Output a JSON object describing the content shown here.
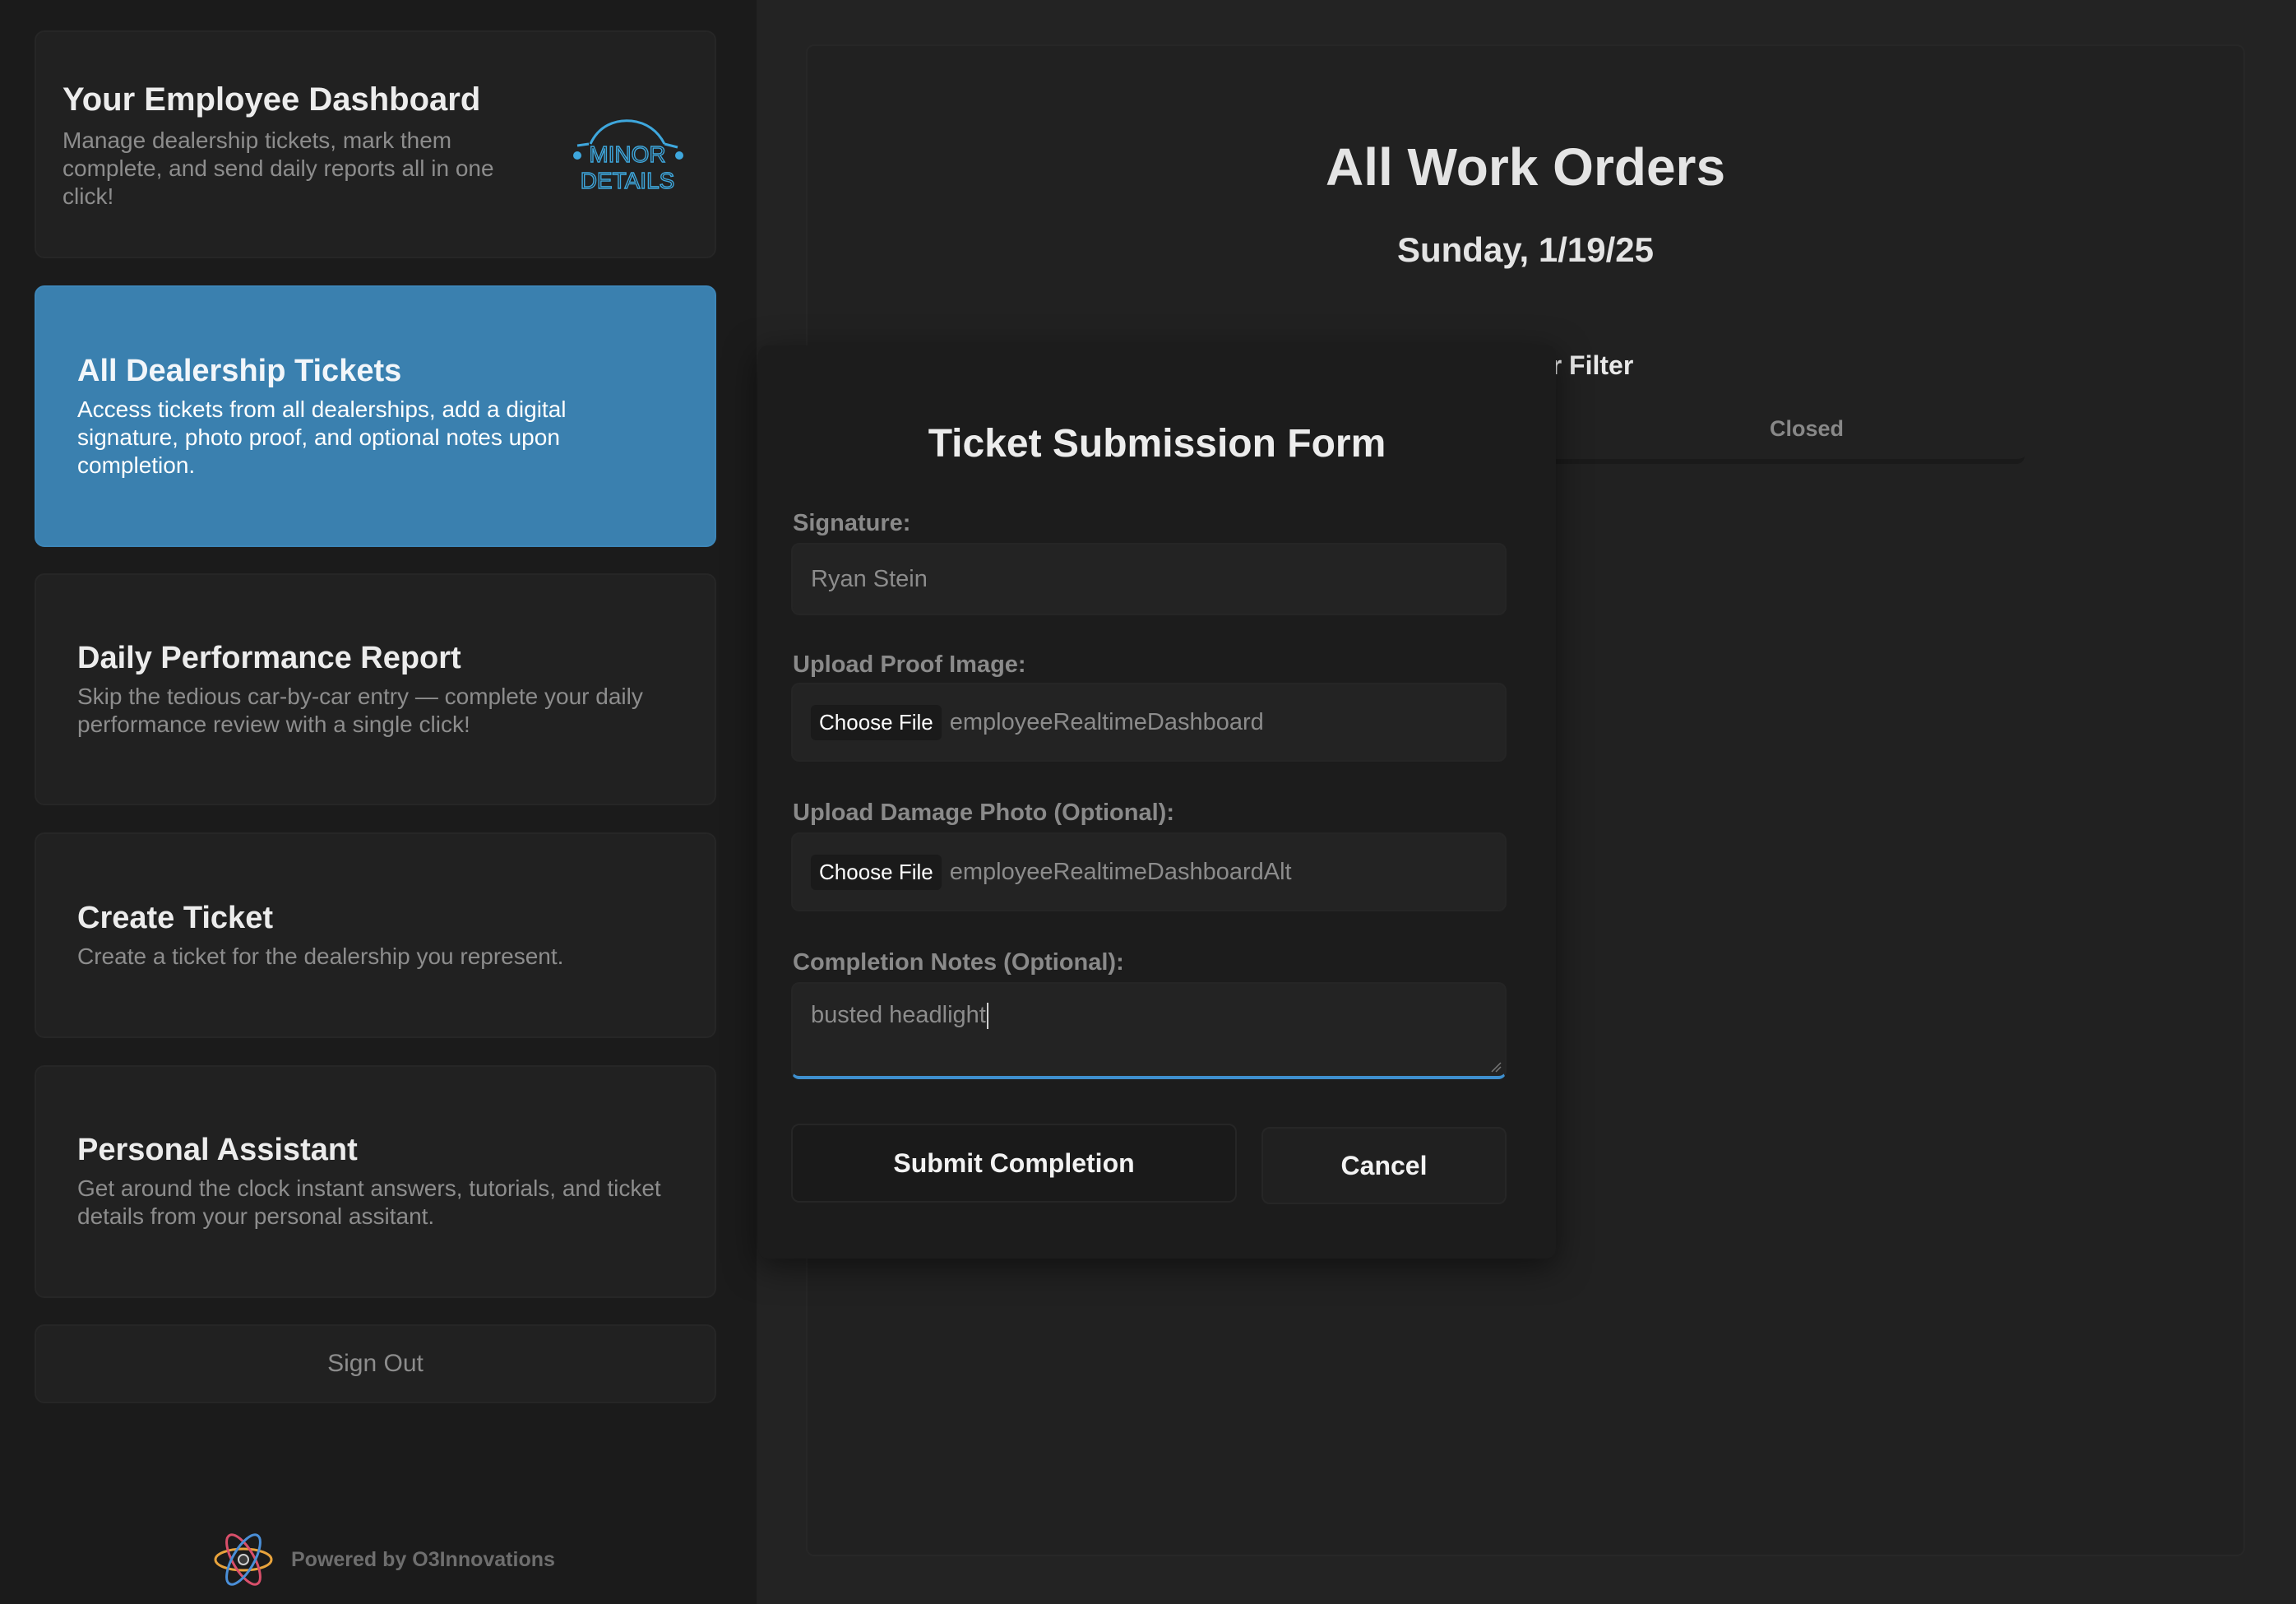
{
  "header": {
    "title": "Your Employee Dashboard",
    "description": "Manage dealership tickets, mark them complete, and send daily reports all in one click!",
    "logo_text_line1": "MINOR",
    "logo_text_line2": "DETAILS",
    "logo_color": "#3ea7dd"
  },
  "nav": [
    {
      "title": "All Dealership Tickets",
      "description": "Access tickets from all dealerships, add a digital signature, photo proof, and optional notes upon completion.",
      "active": true
    },
    {
      "title": "Daily Performance Report",
      "description": "Skip the tedious car-by-car entry — complete your daily performance review with a single click!"
    },
    {
      "title": "Create Ticket",
      "description": "Create a ticket for the dealership you represent."
    },
    {
      "title": "Personal Assistant",
      "description": "Get around the clock instant answers, tutorials, and ticket details from your personal assitant."
    }
  ],
  "signout_label": "Sign Out",
  "footer": {
    "powered_by": "Powered by O3Innovations",
    "icon": "atom-icon"
  },
  "main": {
    "title": "All Work Orders",
    "date": "Sunday, 1/19/25",
    "filter_label": "Work Order Filter",
    "filter_option_visible": "Closed"
  },
  "modal": {
    "title": "Ticket Submission Form",
    "signature_label": "Signature:",
    "signature_value": "Ryan Stein",
    "proof_label": "Upload Proof Image:",
    "proof_button": "Choose File",
    "proof_file": "employeeRealtimeDashboard",
    "damage_label": "Upload Damage Photo (Optional):",
    "damage_button": "Choose File",
    "damage_file": "employeeRealtimeDashboardAlt",
    "notes_label": "Completion Notes (Optional):",
    "notes_value": "busted headlight",
    "submit_label": "Submit Completion",
    "cancel_label": "Cancel"
  },
  "colors": {
    "accent": "#3a80af",
    "focus": "#3e8fce",
    "background": "#242424"
  }
}
